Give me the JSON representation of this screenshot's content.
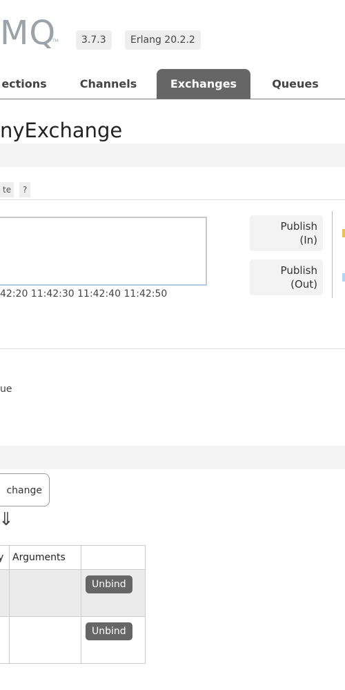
{
  "header": {
    "logo_fragment": "MQ",
    "trademark": "TM",
    "version": "3.7.3",
    "erlang": "Erlang 20.2.2"
  },
  "tabs": [
    "ections",
    "Channels",
    "Exchanges",
    "Queues"
  ],
  "page_title": "nyExchange",
  "rates": {
    "tag_partial": "te",
    "help": "?",
    "time_ticks": "42:20 11:42:30 11:42:40 11:42:50",
    "legend": [
      {
        "line1": "Publish",
        "line2": "(In)",
        "color": "#edc240"
      },
      {
        "line1": "Publish",
        "line2": "(Out)",
        "color": "#afd8f8"
      }
    ]
  },
  "details": {
    "value_partial": "ue"
  },
  "bindings": {
    "exchange_button": "change",
    "arrow": "⇓",
    "columns": [
      "y",
      "Arguments",
      ""
    ],
    "rows": [
      {
        "unbind_label": "Unbind"
      },
      {
        "unbind_label": "Unbind"
      }
    ]
  }
}
